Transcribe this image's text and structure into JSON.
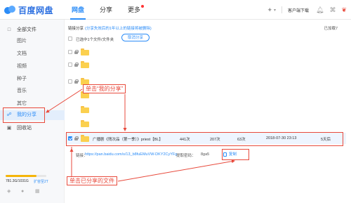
{
  "header": {
    "logo_text": "百度网盘",
    "nav": [
      {
        "label": "网盘",
        "active": true
      },
      {
        "label": "分享",
        "active": false
      },
      {
        "label": "更多",
        "active": false,
        "has_dot": true
      }
    ],
    "client_download": "客户端下载",
    "icons": [
      "star-icon",
      "chevron-down-icon",
      "bell-icon",
      "tshirt-icon",
      "gift-icon"
    ]
  },
  "sidebar": {
    "items": [
      {
        "label": "全部文件",
        "icon": "file-icon"
      },
      {
        "label": "图片",
        "icon": ""
      },
      {
        "label": "文档",
        "icon": ""
      },
      {
        "label": "视频",
        "icon": ""
      },
      {
        "label": "种子",
        "icon": ""
      },
      {
        "label": "音乐",
        "icon": ""
      },
      {
        "label": "其它",
        "icon": ""
      },
      {
        "label": "我的分享",
        "icon": "share-icon",
        "active": true
      },
      {
        "label": "回收站",
        "icon": "trash-icon"
      }
    ],
    "quota_text": "781.3G/1031G",
    "quota_used_fraction": 0.758,
    "expand_link": "扩容至2T",
    "app_icons": [
      "android-icon",
      "apple-icon",
      "windows-icon"
    ]
  },
  "main": {
    "breadcrumb": "链接分享",
    "breadcrumb_note": "(分享失效后的1年以上的链接将被删除)",
    "loaded_text": "已加载7",
    "selection_text": "已选中1个文件/文件夹",
    "cancel_share_label": "取消分享",
    "shared_file": {
      "name": "广播剧《残次品（第一季）》priest【BL】",
      "size": "441次",
      "views": "207次",
      "saves": "63次",
      "date": "2018-07-30 23:13",
      "validity": "5天后"
    },
    "link": {
      "label": "链接：",
      "url": "https://pan.baidu.com/s/13_b8fuEMuVW-DKY2CyYFg",
      "code_label": "提取密码：",
      "code": "8ga5",
      "copy_label": "复制"
    }
  },
  "annotations": {
    "callout_my_share": "单击“我的分享”",
    "callout_shared_file": "单击已分享的文件",
    "color": "#e84a3c"
  }
}
